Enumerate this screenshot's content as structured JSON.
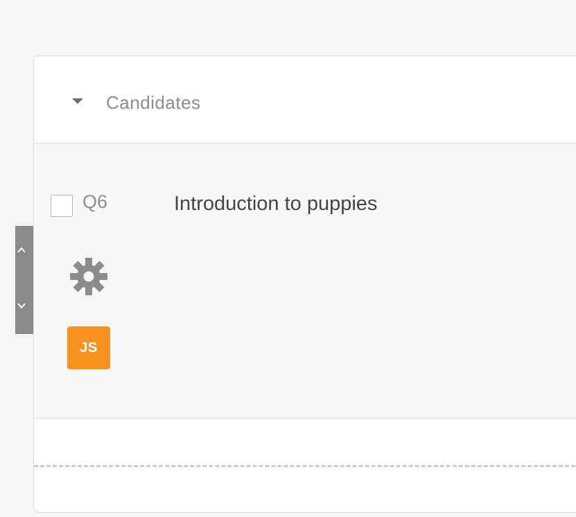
{
  "block": {
    "title": "Candidates"
  },
  "question": {
    "id": "Q6",
    "text": "Introduction to puppies",
    "badge": "JS"
  },
  "colors": {
    "badge": "#f7931e",
    "handle": "#8a8a8a",
    "title_text": "#8c8c8c",
    "question_text": "#444444"
  },
  "icons": {
    "caret": "caret-down-icon",
    "gear": "gear-icon",
    "handle_up": "chevron-up-icon",
    "handle_down": "chevron-down-icon"
  }
}
